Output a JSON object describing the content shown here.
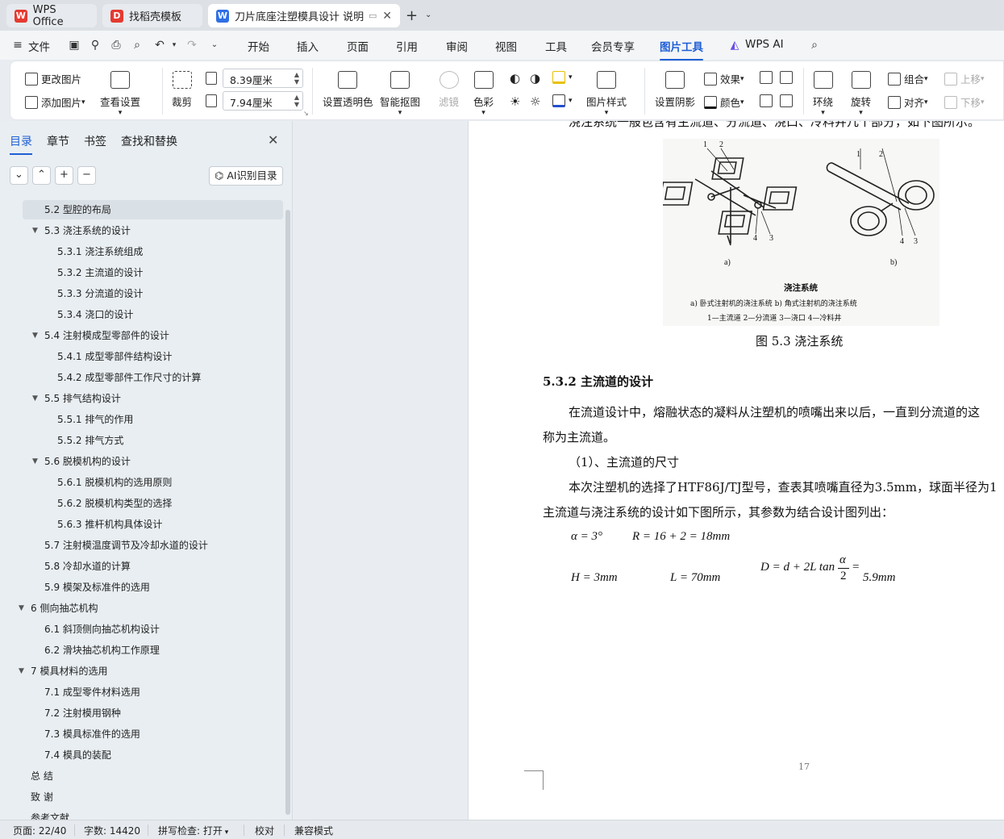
{
  "tabs": [
    {
      "label": "WPS Office",
      "icon": "wps-logo-icon"
    },
    {
      "label": "找稻壳模板",
      "icon": "docer-logo-icon"
    },
    {
      "label": "刀片底座注塑模具设计 说明书",
      "icon": "writer-doc-icon"
    }
  ],
  "menu": {
    "file": "文件",
    "items": [
      "开始",
      "插入",
      "页面",
      "引用",
      "审阅",
      "视图",
      "工具",
      "会员专享",
      "图片工具",
      "WPS AI"
    ],
    "active": "图片工具"
  },
  "ribbon": {
    "change_picture": "更改图片",
    "add_picture": "添加图片",
    "view_settings": "查看设置",
    "crop": "裁剪",
    "width_value": "8.39厘米",
    "height_value": "7.94厘米",
    "set_transparent": "设置透明色",
    "smart_cutout": "智能抠图",
    "filter": "滤镜",
    "color": "色彩",
    "preset_style": "图片样式",
    "set_shadow": "设置阴影",
    "effects": "效果",
    "border_color": "颜色",
    "wrap": "环绕",
    "rotate": "旋转",
    "group": "组合",
    "align": "对齐",
    "move_up": "上移",
    "move_down": "下移"
  },
  "left_pane": {
    "tabs": [
      "目录",
      "章节",
      "书签",
      "查找和替换"
    ],
    "ai_toc_button": "AI识别目录",
    "toc": [
      {
        "label": "5.2  型腔的布局",
        "level": 2,
        "selected": true
      },
      {
        "label": "5.3  浇注系统的设计",
        "level": 2,
        "expandable": true
      },
      {
        "label": "5.3.1  浇注系统组成",
        "level": 3
      },
      {
        "label": "5.3.2  主流道的设计",
        "level": 3
      },
      {
        "label": "5.3.3  分流道的设计",
        "level": 3
      },
      {
        "label": "5.3.4  浇口的设计",
        "level": 3
      },
      {
        "label": "5.4  注射模成型零部件的设计",
        "level": 2,
        "expandable": true
      },
      {
        "label": "5.4.1  成型零部件结构设计",
        "level": 3
      },
      {
        "label": "5.4.2  成型零部件工作尺寸的计算",
        "level": 3
      },
      {
        "label": "5.5  排气结构设计",
        "level": 2,
        "expandable": true
      },
      {
        "label": "5.5.1 排气的作用",
        "level": 3
      },
      {
        "label": "5.5.2 排气方式",
        "level": 3
      },
      {
        "label": "5.6  脱模机构的设计",
        "level": 2,
        "expandable": true
      },
      {
        "label": "5.6.1  脱模机构的选用原则",
        "level": 3
      },
      {
        "label": "5.6.2  脱模机构类型的选择",
        "level": 3
      },
      {
        "label": "5.6.3  推杆机构具体设计",
        "level": 3
      },
      {
        "label": "5.7  注射模温度调节及冷却水道的设计",
        "level": 2
      },
      {
        "label": "5.8  冷却水道的计算",
        "level": 2
      },
      {
        "label": "5.9  模架及标准件的选用",
        "level": 2
      },
      {
        "label": "6  侧向抽芯机构",
        "level": 1,
        "expandable": true
      },
      {
        "label": "6.1  斜顶侧向抽芯机构设计",
        "level": 2
      },
      {
        "label": "6.2  滑块抽芯机构工作原理",
        "level": 2
      },
      {
        "label": "7  模具材料的选用",
        "level": 1,
        "expandable": true
      },
      {
        "label": "7.1  成型零件材料选用",
        "level": 2
      },
      {
        "label": "7.2  注射模用钢种",
        "level": 2
      },
      {
        "label": "7.3  模具标准件的选用",
        "level": 2
      },
      {
        "label": "7.4  模具的装配",
        "level": 2
      },
      {
        "label": "总    结",
        "level": 1
      },
      {
        "label": "致    谢",
        "level": 1
      },
      {
        "label": "参考文献",
        "level": 1
      }
    ]
  },
  "document": {
    "top_line": "浇注系统一般包含有主流道、分流道、浇口、冷料井几个部分，如下图所示。",
    "figure": {
      "labels_a": [
        "1",
        "2",
        "4",
        "3"
      ],
      "labels_b": [
        "1",
        "2",
        "4",
        "3"
      ],
      "sub_a": "a)",
      "sub_b": "b)",
      "title": "浇注系统",
      "desc": "a) 卧式注射机的浇注系统    b) 角式注射机的浇注系统",
      "legend": "1—主流道   2—分流道   3—浇口   4—冷料井"
    },
    "caption": "图 5.3  浇注系统",
    "heading": "5.3.2  主流道的设计",
    "para1": "在流道设计中，熔融状态的凝料从注塑机的喷嘴出来以后，一直到分流道的这",
    "para1b": "称为主流道。",
    "para2": "（1）、主流道的尺寸",
    "para3": "本次注塑机的选择了HTF86J/TJ型号，查表其喷嘴直径为3.5mm，球面半径为1",
    "para4": "主流道与浇注系统的设计如下图所示，其参数为结合设计图列出：",
    "eq1": "α = 3°",
    "eq2": "R = 16 + 2 = 18mm",
    "eq3": "H = 3mm",
    "eq4": "L = 70mm",
    "eq5a": "D = d + 2L tan",
    "eq5frac_num": "α",
    "eq5frac_den": "2",
    "eq5b": "=",
    "eq5c": "5.9mm",
    "page_number": "17"
  },
  "status": {
    "page": "页面: 22/40",
    "words": "字数: 14420",
    "spell": "拼写检查: 打开",
    "proof": "校对",
    "compat": "兼容模式"
  },
  "colors": {
    "accent": "#1f5fd6",
    "wps_red": "#e53a30",
    "writer_blue": "#2f6fe4"
  }
}
